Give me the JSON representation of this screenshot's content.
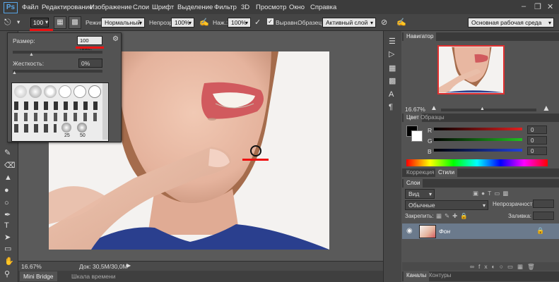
{
  "app": {
    "logo": "Ps"
  },
  "menu": [
    "Файл",
    "Редактирование",
    "Изображение",
    "Слои",
    "Шрифт",
    "Выделение",
    "Фильтр",
    "3D",
    "Просмотр",
    "Окно",
    "Справка"
  ],
  "options": {
    "brush_size": "100",
    "mode_label": "Режим:",
    "mode_value": "Нормальный",
    "opacity_label": "Непрозр.:",
    "opacity_value": "100%",
    "pressure_label": "Наж.:",
    "pressure_value": "100%",
    "align_label": "Выравн.",
    "sample_label": "Образец:",
    "sample_value": "Активный слой",
    "workspace": "Основная рабочая среда"
  },
  "brush_panel": {
    "size_label": "Размер:",
    "size_value": "100 пикс.",
    "hardness_label": "Жесткость:",
    "hardness_value": "0%",
    "preset_sizes": [
      "25",
      "50"
    ]
  },
  "status": {
    "zoom": "16.67%",
    "doc": "Док: 30,5M/30,0M"
  },
  "bottom_tabs": [
    "Mini Bridge",
    "Шкала времени"
  ],
  "navigator": {
    "title": "Навигатор",
    "zoom": "16.67%"
  },
  "color_panel": {
    "tabs": [
      "Цвет",
      "Образцы"
    ],
    "channels": [
      {
        "name": "R",
        "value": "0",
        "color": "#e02020"
      },
      {
        "name": "G",
        "value": "0",
        "color": "#20c020"
      },
      {
        "name": "B",
        "value": "0",
        "color": "#2040e0"
      }
    ]
  },
  "styles_tabs": [
    "Коррекция",
    "Стили"
  ],
  "layers": {
    "title": "Слои",
    "filter_value": "Вид",
    "blend_value": "Обычные",
    "opacity_label": "Непрозрачность:",
    "lock_label": "Закрепить:",
    "fill_label": "Заливка:",
    "layer_name": "Фон"
  },
  "lower_tabs": [
    "Каналы",
    "Контуры"
  ],
  "colors": {
    "accent": "#e11111",
    "panel": "#535353",
    "menubar": "#3c3c3c",
    "selection": "#3d6a9e"
  }
}
